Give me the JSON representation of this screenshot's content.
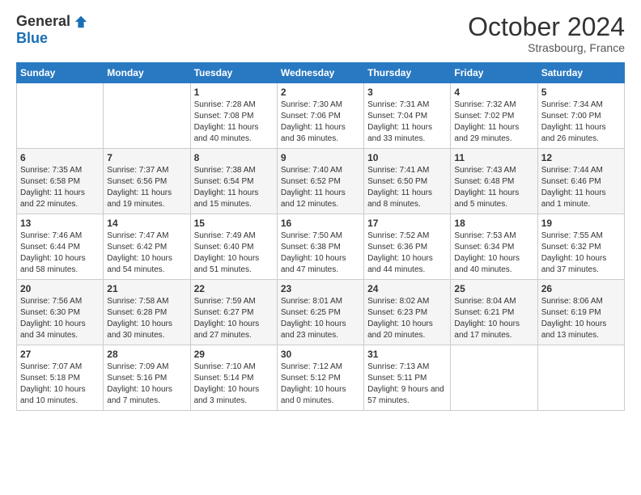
{
  "logo": {
    "general": "General",
    "blue": "Blue"
  },
  "header": {
    "month": "October 2024",
    "location": "Strasbourg, France"
  },
  "weekdays": [
    "Sunday",
    "Monday",
    "Tuesday",
    "Wednesday",
    "Thursday",
    "Friday",
    "Saturday"
  ],
  "weeks": [
    [
      {
        "day": "",
        "info": ""
      },
      {
        "day": "",
        "info": ""
      },
      {
        "day": "1",
        "info": "Sunrise: 7:28 AM\nSunset: 7:08 PM\nDaylight: 11 hours and 40 minutes."
      },
      {
        "day": "2",
        "info": "Sunrise: 7:30 AM\nSunset: 7:06 PM\nDaylight: 11 hours and 36 minutes."
      },
      {
        "day": "3",
        "info": "Sunrise: 7:31 AM\nSunset: 7:04 PM\nDaylight: 11 hours and 33 minutes."
      },
      {
        "day": "4",
        "info": "Sunrise: 7:32 AM\nSunset: 7:02 PM\nDaylight: 11 hours and 29 minutes."
      },
      {
        "day": "5",
        "info": "Sunrise: 7:34 AM\nSunset: 7:00 PM\nDaylight: 11 hours and 26 minutes."
      }
    ],
    [
      {
        "day": "6",
        "info": "Sunrise: 7:35 AM\nSunset: 6:58 PM\nDaylight: 11 hours and 22 minutes."
      },
      {
        "day": "7",
        "info": "Sunrise: 7:37 AM\nSunset: 6:56 PM\nDaylight: 11 hours and 19 minutes."
      },
      {
        "day": "8",
        "info": "Sunrise: 7:38 AM\nSunset: 6:54 PM\nDaylight: 11 hours and 15 minutes."
      },
      {
        "day": "9",
        "info": "Sunrise: 7:40 AM\nSunset: 6:52 PM\nDaylight: 11 hours and 12 minutes."
      },
      {
        "day": "10",
        "info": "Sunrise: 7:41 AM\nSunset: 6:50 PM\nDaylight: 11 hours and 8 minutes."
      },
      {
        "day": "11",
        "info": "Sunrise: 7:43 AM\nSunset: 6:48 PM\nDaylight: 11 hours and 5 minutes."
      },
      {
        "day": "12",
        "info": "Sunrise: 7:44 AM\nSunset: 6:46 PM\nDaylight: 11 hours and 1 minute."
      }
    ],
    [
      {
        "day": "13",
        "info": "Sunrise: 7:46 AM\nSunset: 6:44 PM\nDaylight: 10 hours and 58 minutes."
      },
      {
        "day": "14",
        "info": "Sunrise: 7:47 AM\nSunset: 6:42 PM\nDaylight: 10 hours and 54 minutes."
      },
      {
        "day": "15",
        "info": "Sunrise: 7:49 AM\nSunset: 6:40 PM\nDaylight: 10 hours and 51 minutes."
      },
      {
        "day": "16",
        "info": "Sunrise: 7:50 AM\nSunset: 6:38 PM\nDaylight: 10 hours and 47 minutes."
      },
      {
        "day": "17",
        "info": "Sunrise: 7:52 AM\nSunset: 6:36 PM\nDaylight: 10 hours and 44 minutes."
      },
      {
        "day": "18",
        "info": "Sunrise: 7:53 AM\nSunset: 6:34 PM\nDaylight: 10 hours and 40 minutes."
      },
      {
        "day": "19",
        "info": "Sunrise: 7:55 AM\nSunset: 6:32 PM\nDaylight: 10 hours and 37 minutes."
      }
    ],
    [
      {
        "day": "20",
        "info": "Sunrise: 7:56 AM\nSunset: 6:30 PM\nDaylight: 10 hours and 34 minutes."
      },
      {
        "day": "21",
        "info": "Sunrise: 7:58 AM\nSunset: 6:28 PM\nDaylight: 10 hours and 30 minutes."
      },
      {
        "day": "22",
        "info": "Sunrise: 7:59 AM\nSunset: 6:27 PM\nDaylight: 10 hours and 27 minutes."
      },
      {
        "day": "23",
        "info": "Sunrise: 8:01 AM\nSunset: 6:25 PM\nDaylight: 10 hours and 23 minutes."
      },
      {
        "day": "24",
        "info": "Sunrise: 8:02 AM\nSunset: 6:23 PM\nDaylight: 10 hours and 20 minutes."
      },
      {
        "day": "25",
        "info": "Sunrise: 8:04 AM\nSunset: 6:21 PM\nDaylight: 10 hours and 17 minutes."
      },
      {
        "day": "26",
        "info": "Sunrise: 8:06 AM\nSunset: 6:19 PM\nDaylight: 10 hours and 13 minutes."
      }
    ],
    [
      {
        "day": "27",
        "info": "Sunrise: 7:07 AM\nSunset: 5:18 PM\nDaylight: 10 hours and 10 minutes."
      },
      {
        "day": "28",
        "info": "Sunrise: 7:09 AM\nSunset: 5:16 PM\nDaylight: 10 hours and 7 minutes."
      },
      {
        "day": "29",
        "info": "Sunrise: 7:10 AM\nSunset: 5:14 PM\nDaylight: 10 hours and 3 minutes."
      },
      {
        "day": "30",
        "info": "Sunrise: 7:12 AM\nSunset: 5:12 PM\nDaylight: 10 hours and 0 minutes."
      },
      {
        "day": "31",
        "info": "Sunrise: 7:13 AM\nSunset: 5:11 PM\nDaylight: 9 hours and 57 minutes."
      },
      {
        "day": "",
        "info": ""
      },
      {
        "day": "",
        "info": ""
      }
    ]
  ]
}
